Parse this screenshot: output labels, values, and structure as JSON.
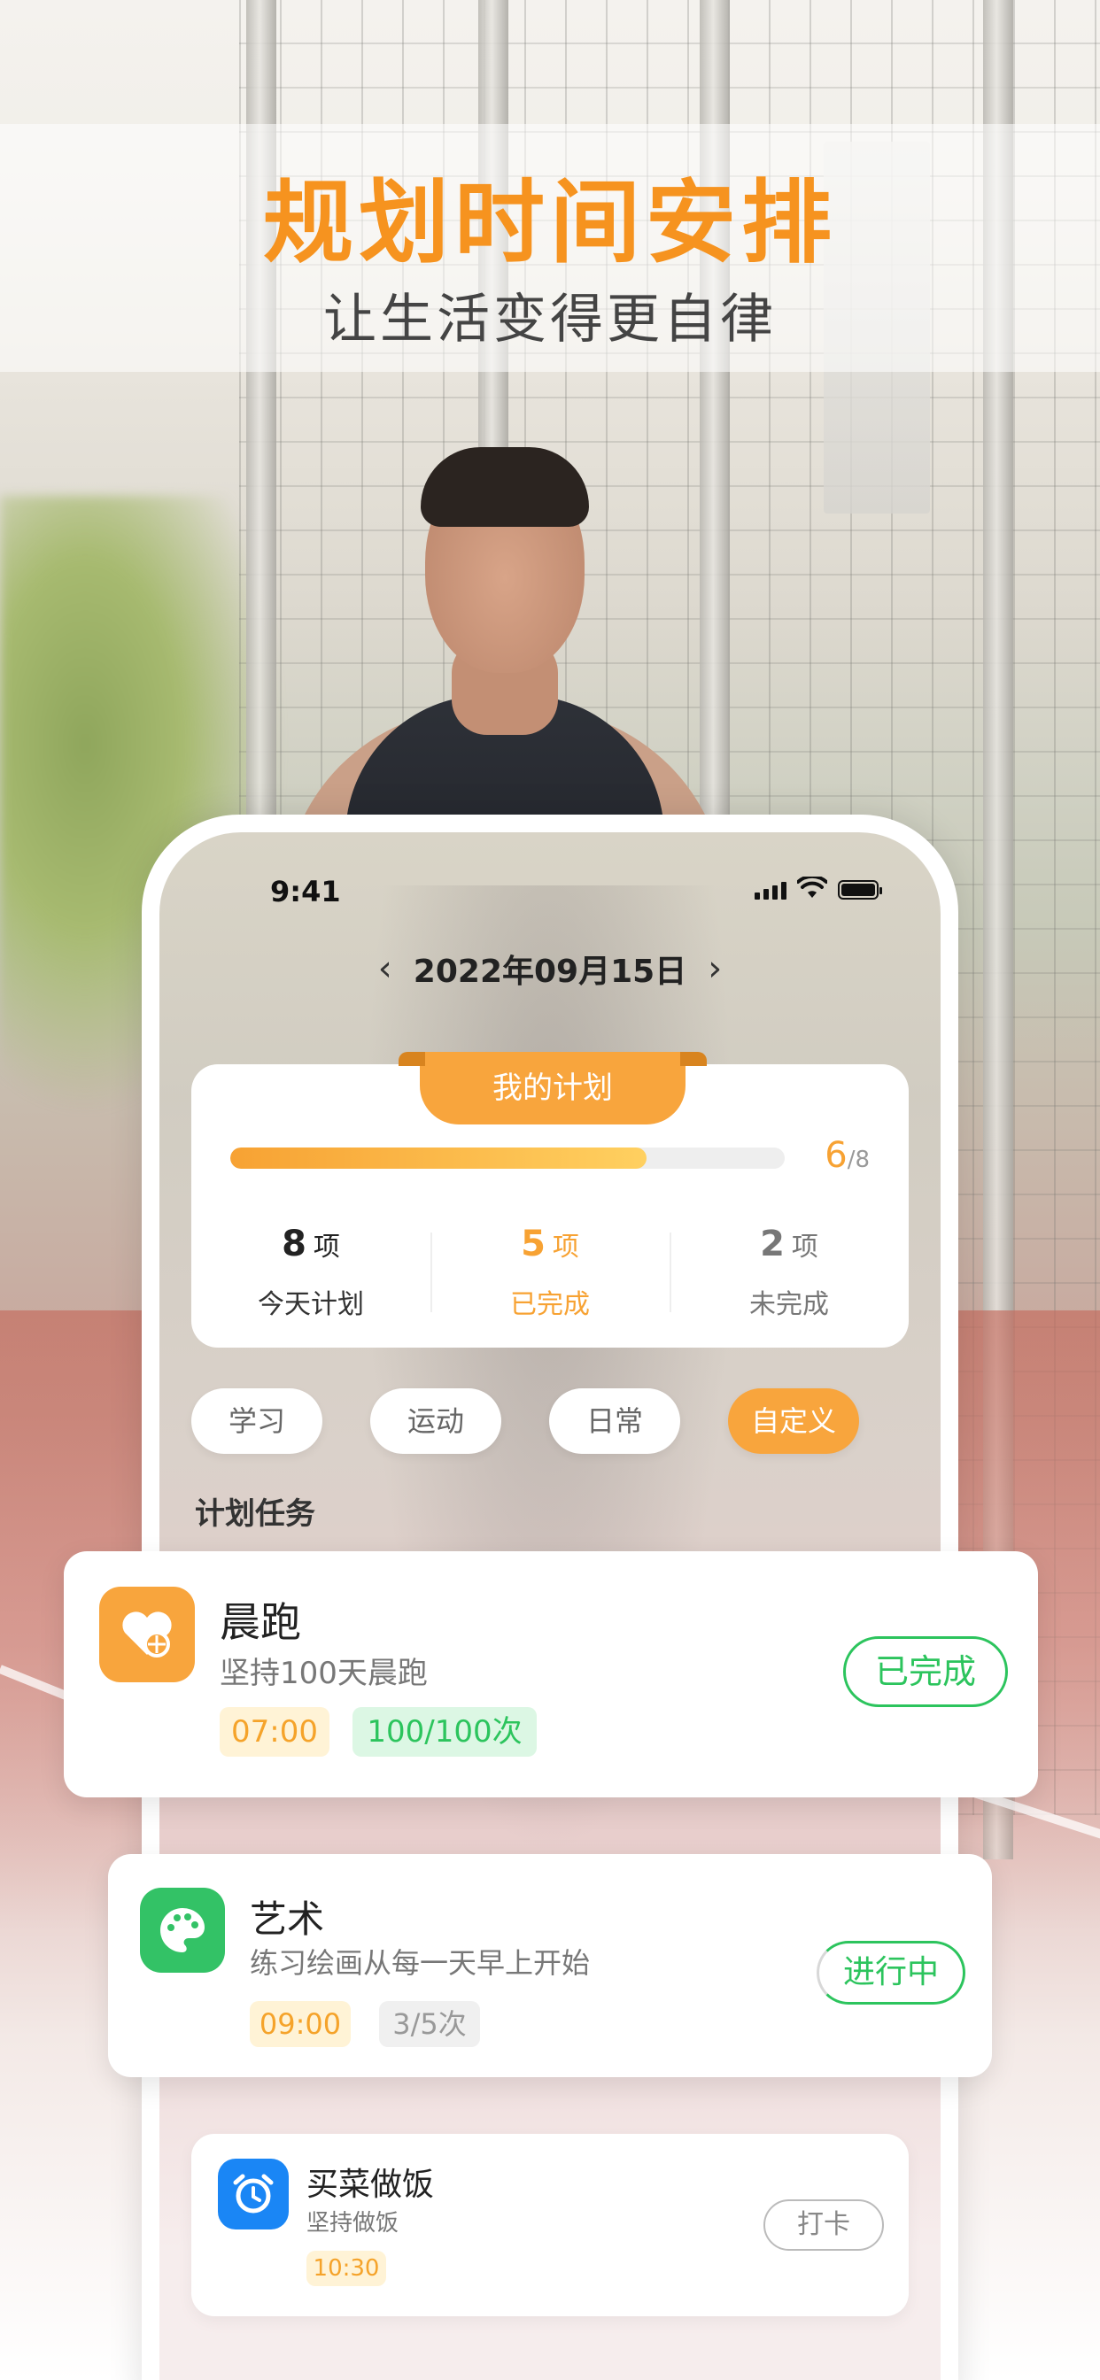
{
  "headline": {
    "title": "规划时间安排",
    "subtitle": "让生活变得更自律"
  },
  "status_bar": {
    "time": "9:41"
  },
  "date_nav": {
    "prev": "‹",
    "date": "2022年09月15日",
    "next": "›"
  },
  "plan": {
    "tab_label": "我的计划",
    "progress": {
      "completed": "6",
      "total": "/8",
      "fraction": 0.75
    },
    "stats": [
      {
        "num": "8",
        "unit": "项",
        "label": "今天计划"
      },
      {
        "num": "5",
        "unit": "项",
        "label": "已完成"
      },
      {
        "num": "2",
        "unit": "项",
        "label": "未完成"
      }
    ]
  },
  "categories": [
    "学习",
    "运动",
    "日常",
    "自定义"
  ],
  "section_title": "计划任务",
  "tasks": [
    {
      "title": "晨跑",
      "subtitle": "坚持100天晨跑",
      "time": "07:00",
      "count": "100/100次",
      "status": "已完成",
      "icon": "heart-target-icon",
      "icon_color": "#f8a53d"
    },
    {
      "title": "艺术",
      "subtitle": "练习绘画从每一天早上开始",
      "time": "09:00",
      "count": "3/5次",
      "status": "进行中",
      "icon": "palette-icon",
      "icon_color": "#33c266"
    },
    {
      "title": "买菜做饭",
      "subtitle": "坚持做饭",
      "time": "10:30",
      "status": "打卡",
      "icon": "alarm-clock-icon",
      "icon_color": "#1a86f5"
    }
  ],
  "colors": {
    "accent": "#f8a53d",
    "title": "#f6931f",
    "success": "#2cc45d",
    "blue": "#1a86f5"
  }
}
